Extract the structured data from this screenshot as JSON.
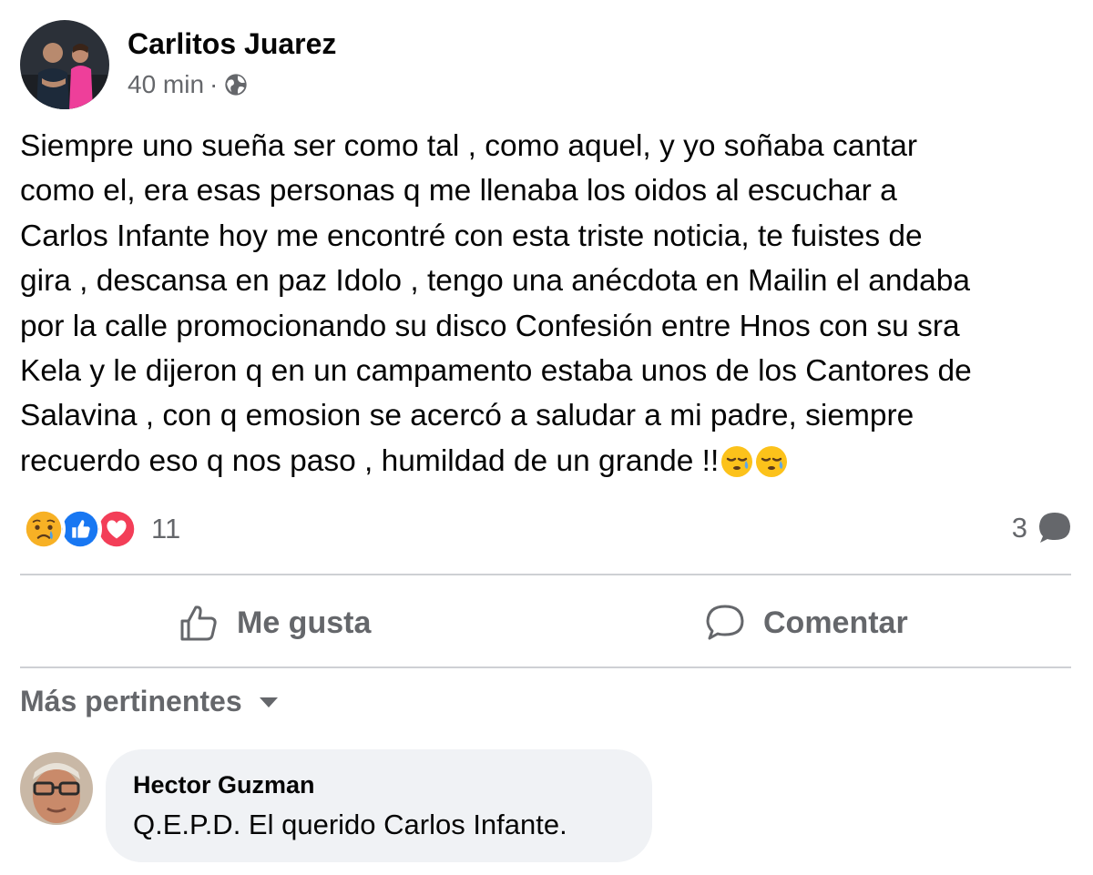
{
  "post": {
    "author": "Carlitos Juarez",
    "time": "40 min",
    "separator": "·",
    "privacy_icon": "globe-icon",
    "text": "Siempre uno sueña ser como tal , como aquel, y yo soñaba cantar\ncomo el, era esas  personas q me llenaba los oidos al escuchar a\nCarlos Infante hoy me encontré con esta triste noticia, te fuistes de\ngira , descansa en paz Idolo , tengo una anécdota en Mailin el andaba\npor la calle promocionando su disco Confesión entre Hnos con su sra\nKela y le dijeron q en un campamento  estaba unos de los Cantores de\nSalavina , con q emosion se acercó a saludar a mi padre, siempre\nrecuerdo eso q nos paso , humildad de un grande !!",
    "trailing_emojis": [
      "sleepy-face-emoji",
      "sleepy-face-emoji"
    ]
  },
  "reactions": {
    "icons": [
      "sad-reaction-icon",
      "like-reaction-icon",
      "love-reaction-icon"
    ],
    "count": "11"
  },
  "comments_summary": {
    "count": "3",
    "icon": "comment-bubble-icon"
  },
  "actions": {
    "like_label": "Me gusta",
    "comment_label": "Comentar"
  },
  "sort": {
    "label": "Más pertinentes",
    "icon": "caret-down-icon"
  },
  "comments": [
    {
      "author": "Hector Guzman",
      "text": "Q.E.P.D. El querido Carlos Infante."
    }
  ],
  "colors": {
    "like_blue": "#1877f2",
    "love_red": "#f33e58",
    "sad_yellow": "#f7b125",
    "secondary_text": "#65676b",
    "divider": "#ced0d4",
    "bubble_bg": "#f0f2f5"
  }
}
